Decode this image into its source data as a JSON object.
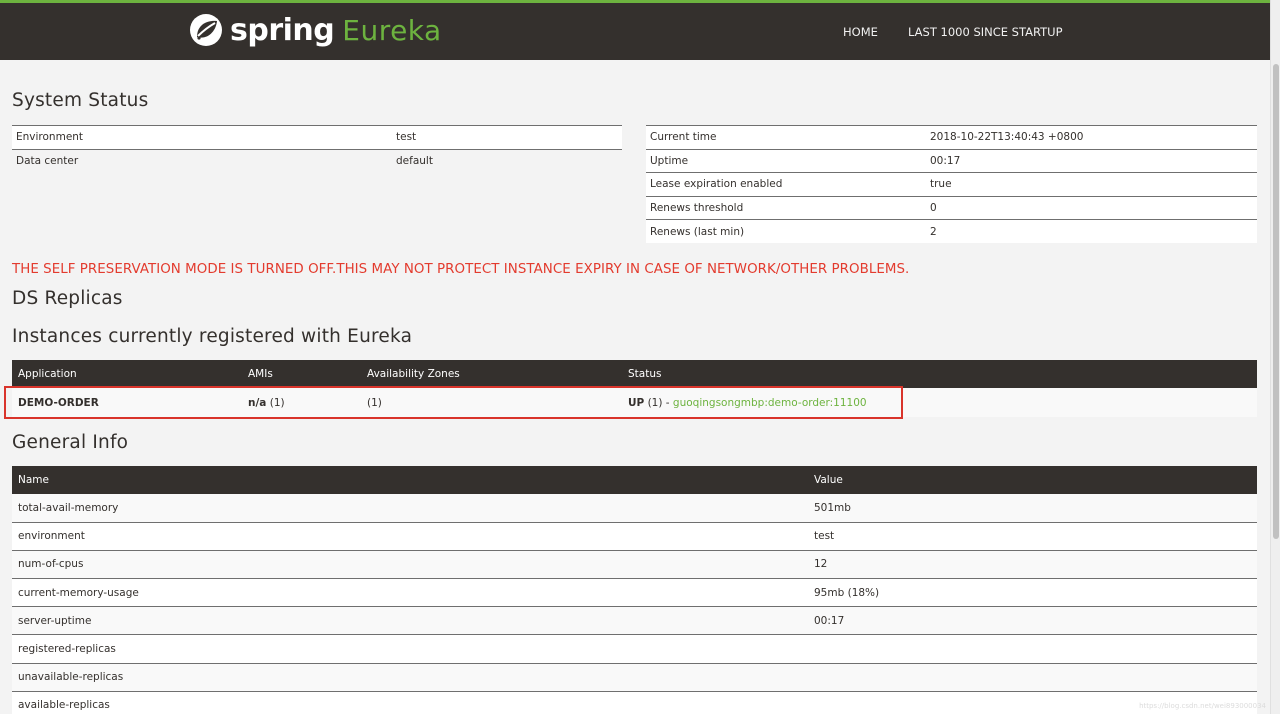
{
  "header": {
    "brand": "spring",
    "product": "Eureka",
    "nav": [
      "HOME",
      "LAST 1000 SINCE STARTUP"
    ]
  },
  "system_status": {
    "title": "System Status",
    "left": [
      {
        "key": "Environment",
        "value": "test"
      },
      {
        "key": "Data center",
        "value": "default"
      }
    ],
    "right": [
      {
        "key": "Current time",
        "value": "2018-10-22T13:40:43 +0800"
      },
      {
        "key": "Uptime",
        "value": "00:17"
      },
      {
        "key": "Lease expiration enabled",
        "value": "true"
      },
      {
        "key": "Renews threshold",
        "value": "0"
      },
      {
        "key": "Renews (last min)",
        "value": "2"
      }
    ]
  },
  "warning": "THE SELF PRESERVATION MODE IS TURNED OFF.THIS MAY NOT PROTECT INSTANCE EXPIRY IN CASE OF NETWORK/OTHER PROBLEMS.",
  "ds_replicas": {
    "title": "DS Replicas"
  },
  "instances": {
    "title": "Instances currently registered with Eureka",
    "columns": [
      "Application",
      "AMIs",
      "Availability Zones",
      "Status"
    ],
    "rows": [
      {
        "application": "DEMO-ORDER",
        "amis_bold": "n/a",
        "amis_count": "(1)",
        "zones": "(1)",
        "status_bold": "UP",
        "status_count": "(1) -",
        "status_link": "guoqingsongmbp:demo-order:11100"
      }
    ]
  },
  "general_info": {
    "title": "General Info",
    "columns": [
      "Name",
      "Value"
    ],
    "rows": [
      {
        "name": "total-avail-memory",
        "value": "501mb"
      },
      {
        "name": "environment",
        "value": "test"
      },
      {
        "name": "num-of-cpus",
        "value": "12"
      },
      {
        "name": "current-memory-usage",
        "value": "95mb (18%)"
      },
      {
        "name": "server-uptime",
        "value": "00:17"
      },
      {
        "name": "registered-replicas",
        "value": ""
      },
      {
        "name": "unavailable-replicas",
        "value": ""
      },
      {
        "name": "available-replicas",
        "value": ""
      }
    ]
  },
  "watermark": "https://blog.csdn.net/wei893000034",
  "colors": {
    "accent": "#6db33f",
    "header_bg": "#34302d",
    "warning": "#e33b2e",
    "highlight_box": "#d9342b"
  }
}
